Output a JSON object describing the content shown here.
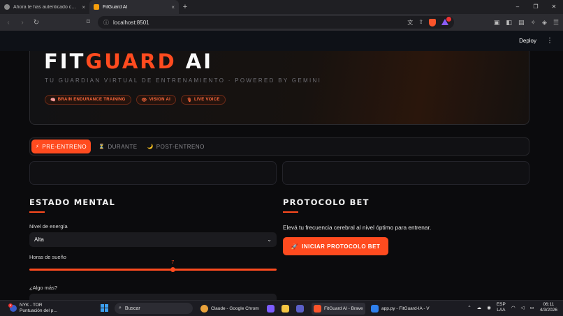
{
  "browser": {
    "tabs": [
      {
        "title": "Ahora te has autenticado con la CLI d",
        "close": "×"
      },
      {
        "title": "FitGuard AI",
        "close": "×"
      }
    ],
    "new_tab": "+",
    "window_controls": [
      "–",
      "❐",
      "✕"
    ],
    "url": "localhost:8501"
  },
  "streamlit_header": {
    "deploy": "Deploy",
    "menu": "⋮"
  },
  "hero": {
    "title_a": "FIT",
    "title_b": "GUARD",
    "title_c": " AI",
    "subtitle": "TU GUARDIAN VIRTUAL DE ENTRENAMIENTO · POWERED BY GEMINI",
    "chips": [
      {
        "icon": "🧠",
        "label": "BRAIN ENDURANCE TRAINING"
      },
      {
        "icon": "👁",
        "label": "VISION AI"
      },
      {
        "icon": "🎙",
        "label": "LIVE VOICE"
      }
    ]
  },
  "tabs": [
    {
      "icon": "⚡",
      "label": "PRE-ENTRENO",
      "active": true
    },
    {
      "icon": "⏳",
      "label": "DURANTE",
      "active": false
    },
    {
      "icon": "🌙",
      "label": "POST-ENTRENO",
      "active": false
    }
  ],
  "left": {
    "title": "ESTADO MENTAL",
    "energy_label": "Nivel de energía",
    "energy_value": "Alta",
    "sleep_label": "Horas de sueño",
    "sleep_value": "7",
    "sleep_fraction": 0.58,
    "more_label": "¿Algo más?"
  },
  "right": {
    "title": "PROTOCOLO BET",
    "description": "Elevá tu frecuencia cerebral al nivel óptimo para entrenar.",
    "button_icon": "🚀",
    "button_label": "INICIAR PROTOCOLO BET"
  },
  "taskbar": {
    "weather_badge": "1",
    "weather_line1": "NYK - TOR",
    "weather_line2": "Puntuación del p...",
    "search": "Buscar",
    "apps": [
      {
        "label": "Claude - Google Chrom",
        "color": "#e9a23b"
      },
      {
        "label": "FitGuard AI - Brave",
        "color": "#fb542b"
      },
      {
        "label": "app.py - FitGuard-IA - V",
        "color": "#2f80ed"
      }
    ],
    "lang1": "ESP",
    "lang2": "LAA",
    "time": "06:11",
    "date": "4/3/2026"
  }
}
